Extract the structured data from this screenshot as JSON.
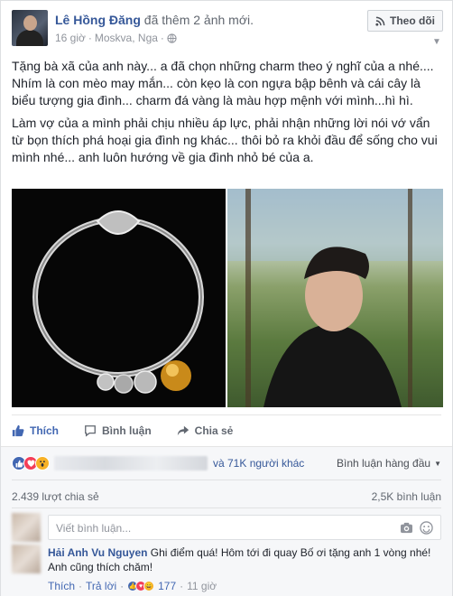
{
  "post": {
    "author": "Lê Hồng Đăng",
    "action": "đã thêm 2 ảnh mới.",
    "time": "16 giờ",
    "location": "Moskva, Nga",
    "separator": "·",
    "follow_label": "Theo dõi",
    "paragraphs": [
      "Tặng bà xã của anh này... a đã chọn những charm theo ý nghĩ của a nhé.... Nhím là con mèo may mắn... còn kẹo là con ngựa bập bênh và cái cây là biểu tượng gia đình... charm đá vàng là màu hợp mệnh với mình...hì hì.",
      "Làm vợ của a mình phải chịu nhiều áp lực, phải nhận những lời nói vớ vẩn từ bọn thích phá hoại gia đình ng khác... thôi bỏ ra khỏi đầu để sống cho vui mình nhé... anh luôn hướng về gia đình nhỏ bé của a."
    ]
  },
  "actions": {
    "like": "Thích",
    "comment": "Bình luận",
    "share": "Chia sẻ"
  },
  "reactions": {
    "others": "và 71K người khác",
    "top_comments": "Bình luận hàng đầu",
    "shares": "2.439 lượt chia sẻ",
    "comments": "2,5K bình luận"
  },
  "comment_input": {
    "placeholder": "Viết bình luận..."
  },
  "comment": {
    "author": "Hải Anh Vu Nguyen",
    "text": "Ghi điểm quá! Hôm tới đi quay Bố ơi tặng anh 1 vòng nhé! Anh cũng thích chăm!",
    "like": "Thích",
    "reply": "Trả lời",
    "reaction_count": "177",
    "time": "11 giờ",
    "dot": "·"
  },
  "colors": {
    "link": "#365899",
    "like_blue": "#4267b2",
    "love_red": "#f33e58",
    "wow_yellow": "#f7b125"
  }
}
